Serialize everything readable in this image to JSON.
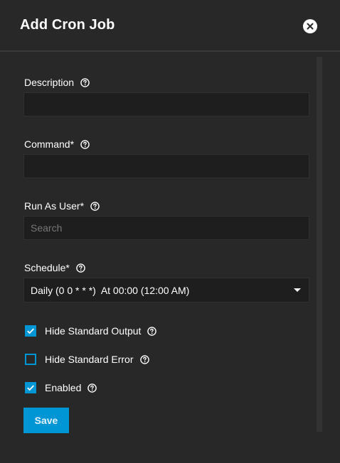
{
  "dialog": {
    "title": "Add Cron Job"
  },
  "fields": {
    "description": {
      "label": "Description",
      "value": ""
    },
    "command": {
      "label": "Command",
      "required_mark": "*",
      "value": ""
    },
    "run_as_user": {
      "label": "Run As User",
      "required_mark": "*",
      "placeholder": "Search",
      "value": ""
    },
    "schedule": {
      "label": "Schedule",
      "required_mark": "*",
      "selected": "Daily (0 0 * * *)  At 00:00 (12:00 AM)"
    }
  },
  "checkboxes": {
    "hide_stdout": {
      "label": "Hide Standard Output",
      "checked": true
    },
    "hide_stderr": {
      "label": "Hide Standard Error",
      "checked": false
    },
    "enabled": {
      "label": "Enabled",
      "checked": true
    }
  },
  "actions": {
    "save_label": "Save"
  },
  "colors": {
    "accent": "#0095d5",
    "background": "#282828",
    "input_background": "#1e1e1e"
  },
  "icons": {
    "close": "close-icon",
    "help": "help-circle-icon",
    "dropdown": "caret-down-icon",
    "check": "check-icon"
  }
}
